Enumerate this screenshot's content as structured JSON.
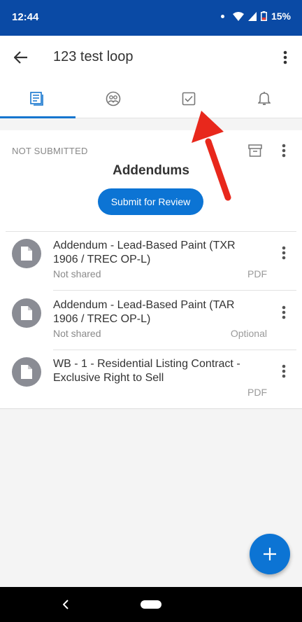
{
  "status_bar": {
    "time": "12:44",
    "battery": "15%"
  },
  "app_bar": {
    "title": "123 test loop"
  },
  "tabs": [
    {
      "icon": "documents-icon",
      "active": true
    },
    {
      "icon": "people-icon",
      "active": false
    },
    {
      "icon": "tasks-checkbox-icon",
      "active": false
    },
    {
      "icon": "notifications-bell-icon",
      "active": false
    }
  ],
  "folder": {
    "status": "NOT SUBMITTED",
    "title": "Addendums",
    "submit_label": "Submit for Review"
  },
  "documents": [
    {
      "title": "Addendum - Lead-Based Paint (TXR 1906 / TREC OP-L)",
      "sharing": "Not shared",
      "tag": "PDF"
    },
    {
      "title": "Addendum - Lead-Based Paint (TAR 1906 / TREC OP-L)",
      "sharing": "Not shared",
      "tag": "Optional"
    },
    {
      "title": "WB - 1 - Residential Listing Contract - Exclusive Right to Sell",
      "sharing": "",
      "tag": "PDF"
    }
  ],
  "colors": {
    "primary": "#0c74d4",
    "status_bar": "#0a4aa5",
    "annotation_arrow": "#e8281c"
  }
}
